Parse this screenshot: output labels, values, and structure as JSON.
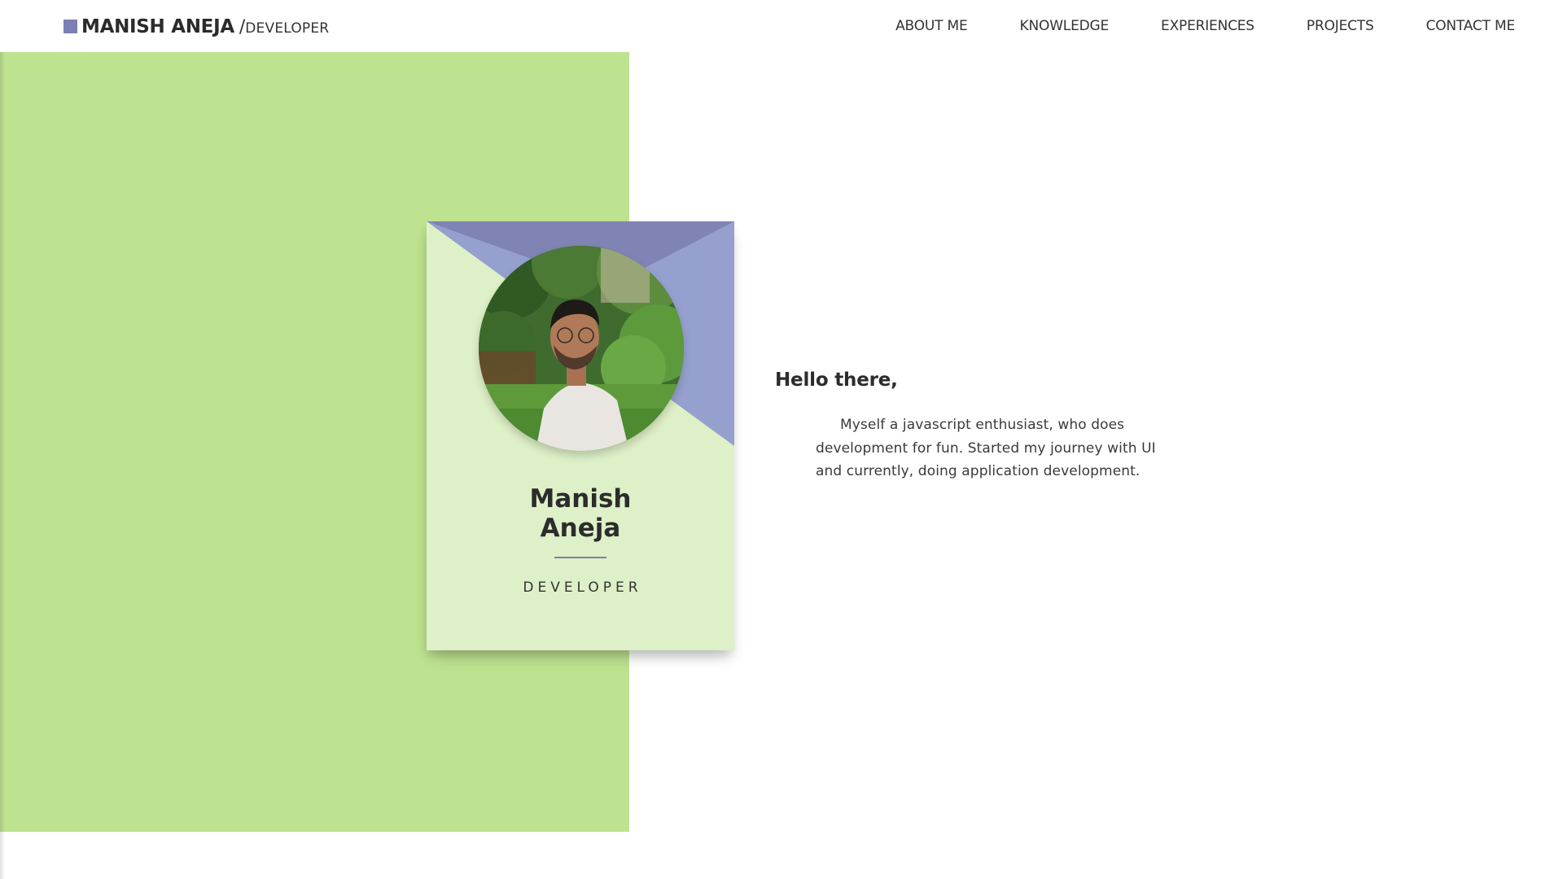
{
  "brand": {
    "name": "MANISH ANEJA",
    "separator": "/",
    "role": "DEVELOPER"
  },
  "nav": {
    "items": [
      {
        "label": "ABOUT ME"
      },
      {
        "label": "KNOWLEDGE"
      },
      {
        "label": "EXPERIENCES"
      },
      {
        "label": "PROJECTS"
      },
      {
        "label": "CONTACT ME"
      }
    ]
  },
  "card": {
    "name_first": "Manish",
    "name_last": "Aneja",
    "role": "DEVELOPER"
  },
  "intro": {
    "greeting": "Hello there,",
    "text": "Myself a javascript enthusiast, who does development for fun. Started my journey with UI and currently, doing application development."
  },
  "colors": {
    "accent": "#7b7fb5",
    "accent_light": "#96a0ce",
    "green": "#bee390",
    "card_green": "#def0c7"
  }
}
